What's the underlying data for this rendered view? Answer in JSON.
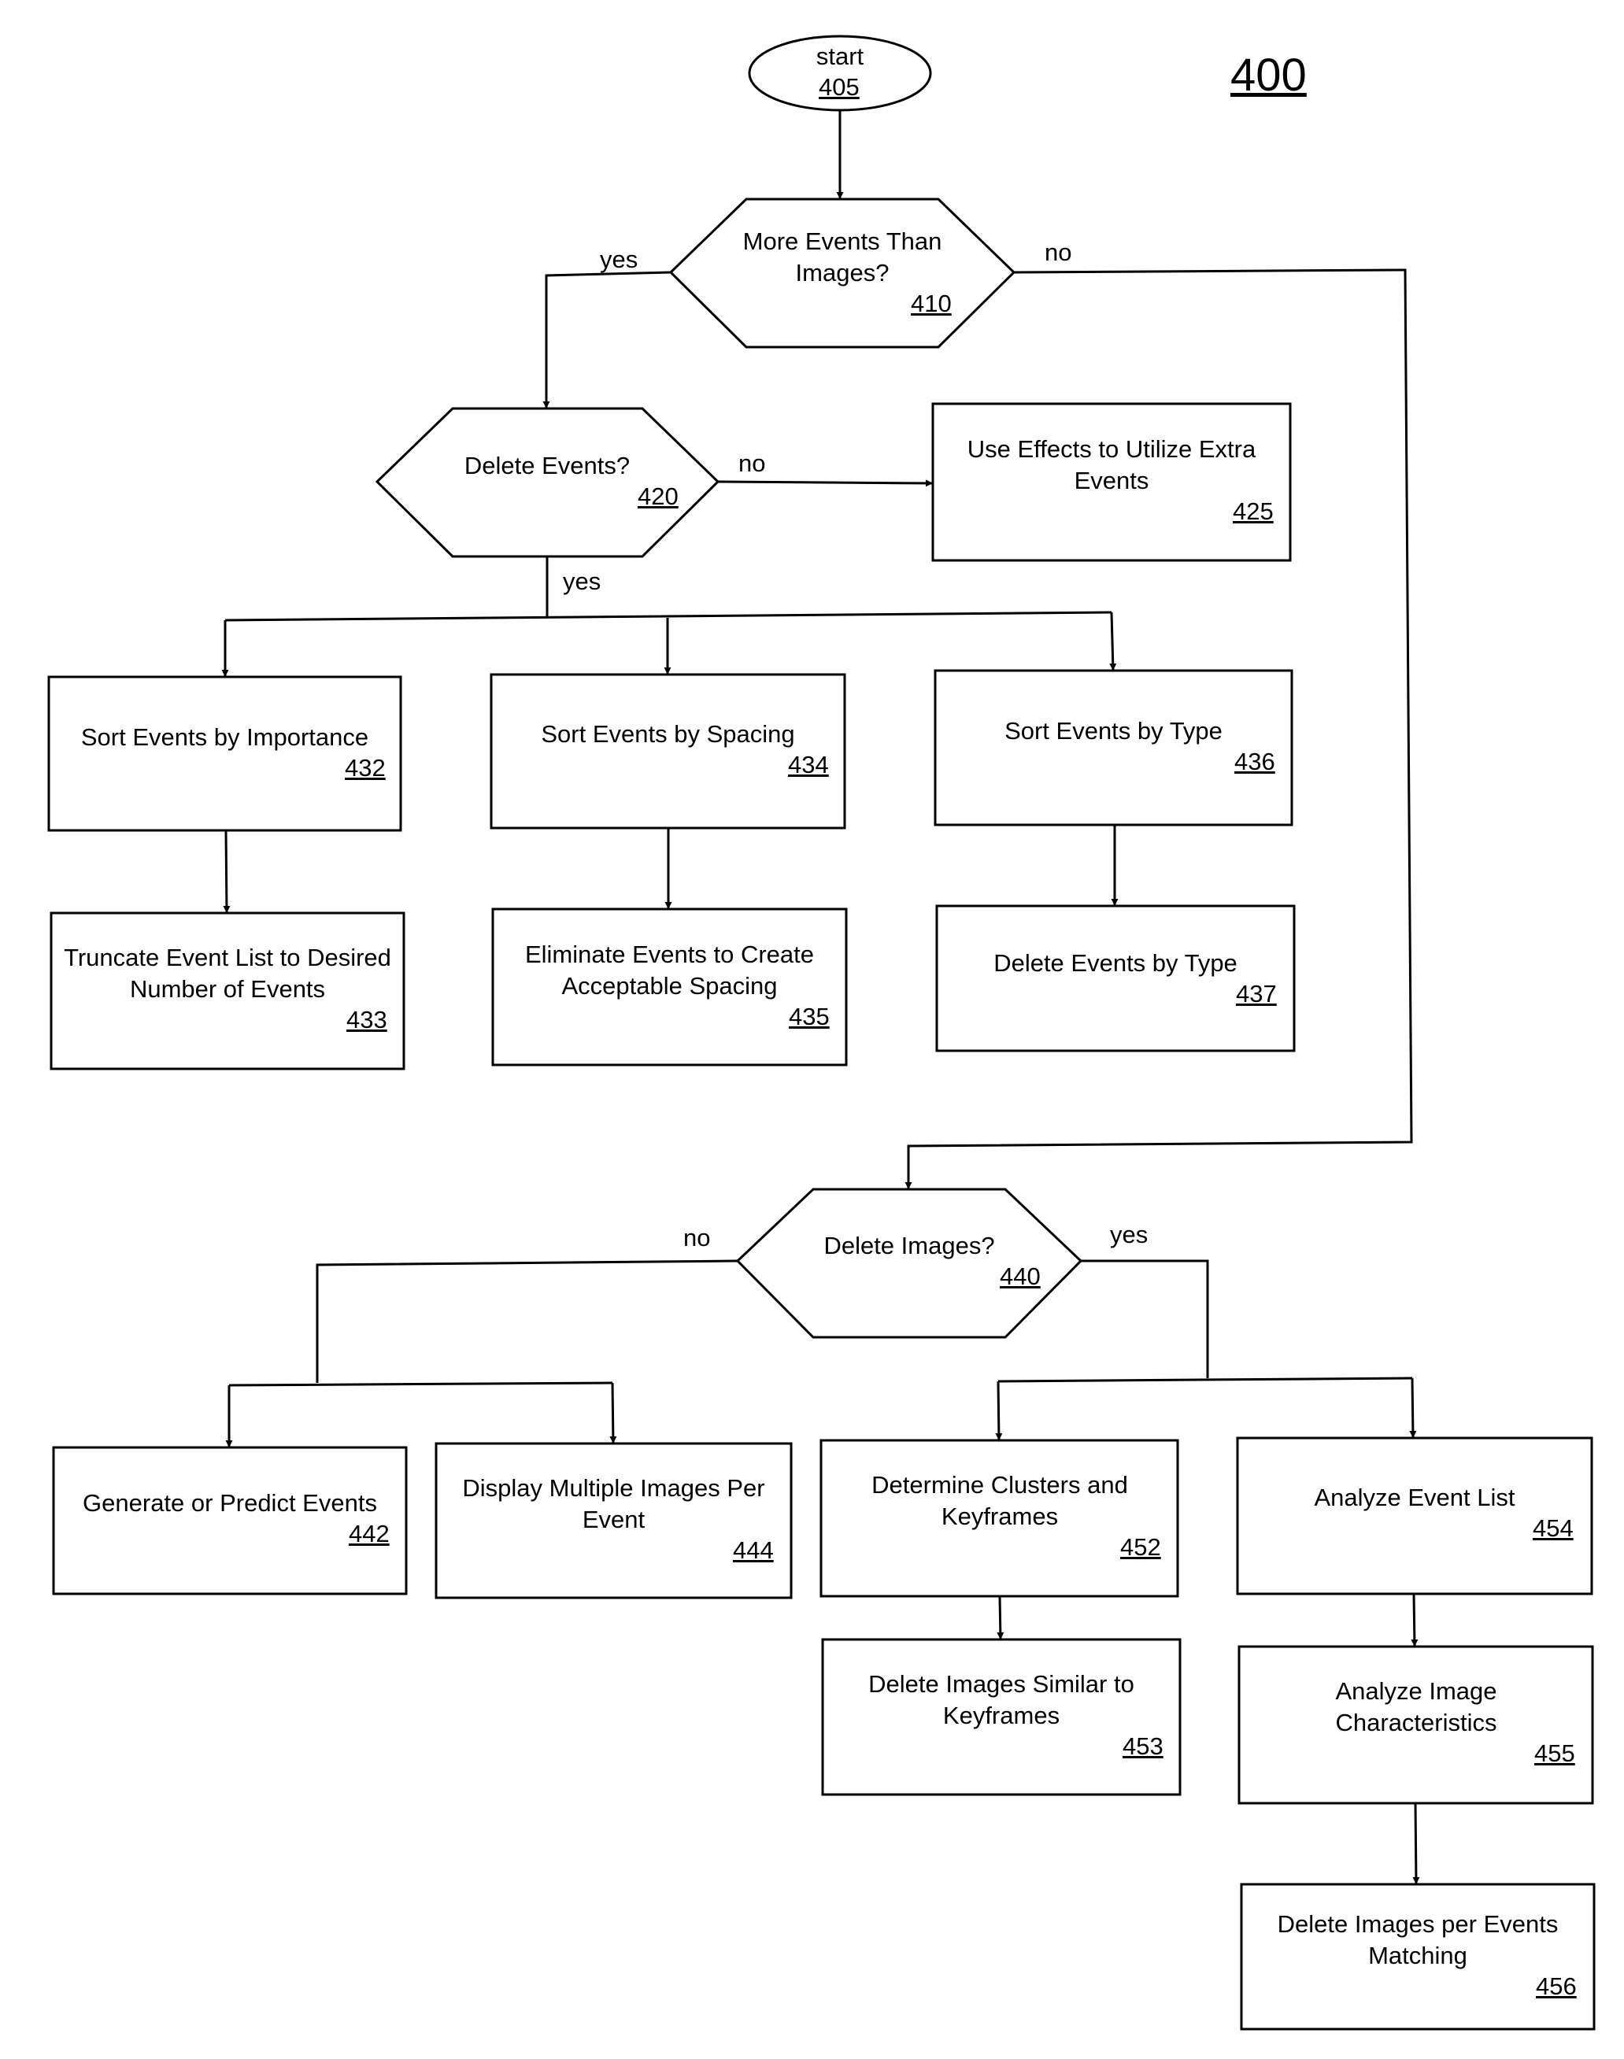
{
  "figure_number": "400",
  "nodes": {
    "n405": {
      "text": "start",
      "ref": "405",
      "shape": "ellipse"
    },
    "n410": {
      "text": "More Events Than Images?",
      "ref": "410",
      "shape": "decision"
    },
    "n420": {
      "text": "Delete Events?",
      "ref": "420",
      "shape": "decision"
    },
    "n425": {
      "text": "Use Effects to Utilize Extra Events",
      "ref": "425",
      "shape": "process"
    },
    "n432": {
      "text": "Sort Events by Importance",
      "ref": "432",
      "shape": "process"
    },
    "n433": {
      "text": "Truncate Event List to Desired Number of Events",
      "ref": "433",
      "shape": "process"
    },
    "n434": {
      "text": "Sort Events by Spacing",
      "ref": "434",
      "shape": "process"
    },
    "n435": {
      "text": "Eliminate Events to Create Acceptable Spacing",
      "ref": "435",
      "shape": "process"
    },
    "n436": {
      "text": "Sort Events by Type",
      "ref": "436",
      "shape": "process"
    },
    "n437": {
      "text": "Delete Events by Type",
      "ref": "437",
      "shape": "process"
    },
    "n440": {
      "text": "Delete Images?",
      "ref": "440",
      "shape": "decision"
    },
    "n442": {
      "text": "Generate or Predict Events",
      "ref": "442",
      "shape": "process"
    },
    "n444": {
      "text": "Display Multiple Images Per Event",
      "ref": "444",
      "shape": "process"
    },
    "n452": {
      "text": "Determine Clusters and Keyframes",
      "ref": "452",
      "shape": "process"
    },
    "n453": {
      "text": "Delete Images Similar to Keyframes",
      "ref": "453",
      "shape": "process"
    },
    "n454": {
      "text": "Analyze Event List",
      "ref": "454",
      "shape": "process"
    },
    "n455": {
      "text": "Analyze Image Characteristics",
      "ref": "455",
      "shape": "process"
    },
    "n456": {
      "text": "Delete Images per Events Matching",
      "ref": "456",
      "shape": "process"
    }
  },
  "edges": [
    {
      "from": "405",
      "to": "410",
      "label": ""
    },
    {
      "from": "410",
      "to": "420",
      "label": "yes"
    },
    {
      "from": "410",
      "to": "440",
      "label": "no"
    },
    {
      "from": "420",
      "to": "425",
      "label": "no"
    },
    {
      "from": "420",
      "to": "432",
      "label": "yes"
    },
    {
      "from": "420",
      "to": "434",
      "label": ""
    },
    {
      "from": "420",
      "to": "436",
      "label": ""
    },
    {
      "from": "432",
      "to": "433",
      "label": ""
    },
    {
      "from": "434",
      "to": "435",
      "label": ""
    },
    {
      "from": "436",
      "to": "437",
      "label": ""
    },
    {
      "from": "440",
      "to": "442",
      "label": "no"
    },
    {
      "from": "440",
      "to": "444",
      "label": ""
    },
    {
      "from": "440",
      "to": "452",
      "label": "yes"
    },
    {
      "from": "440",
      "to": "454",
      "label": ""
    },
    {
      "from": "452",
      "to": "453",
      "label": ""
    },
    {
      "from": "454",
      "to": "455",
      "label": ""
    },
    {
      "from": "455",
      "to": "456",
      "label": ""
    }
  ],
  "edge_labels": {
    "yes_410": "yes",
    "no_410": "no",
    "no_420": "no",
    "yes_420": "yes",
    "no_440": "no",
    "yes_440": "yes"
  }
}
